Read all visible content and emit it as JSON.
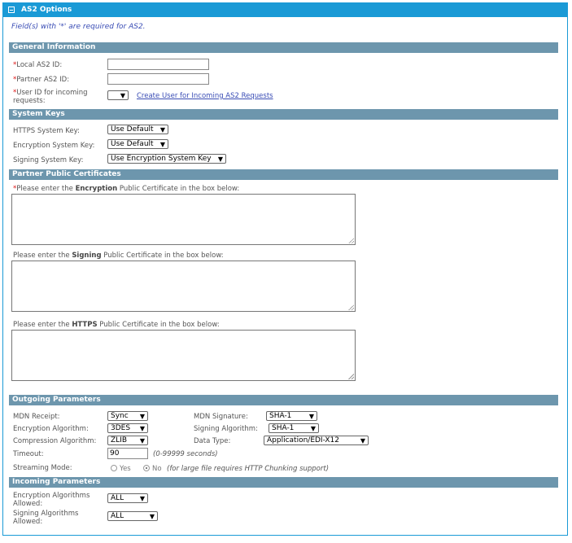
{
  "panel": {
    "title": "AS2 Options",
    "required_note": "Field(s) with '*' are required for AS2."
  },
  "general": {
    "header": "General Information",
    "local_id_label": "Local AS2 ID:",
    "partner_id_label": "Partner AS2 ID:",
    "user_id_label_1": "User ID for incoming",
    "user_id_label_2": "requests:",
    "create_user_link": "Create User for Incoming AS2 Requests"
  },
  "system_keys": {
    "header": "System Keys",
    "https_label": "HTTPS System Key:",
    "https_value": "Use Default",
    "encryption_label": "Encryption System Key:",
    "encryption_value": "Use Default",
    "signing_label": "Signing System Key:",
    "signing_value": "Use Encryption System Key"
  },
  "certs": {
    "header": "Partner Public Certificates",
    "enc_pre": "Please enter the ",
    "enc_bold": "Encryption",
    "enc_post": " Public Certificate in the box below:",
    "sign_pre": "Please enter the ",
    "sign_bold": "Signing",
    "sign_post": " Public Certificate in the box below:",
    "https_pre": "Please enter the ",
    "https_bold": "HTTPS",
    "https_post": " Public Certificate in the box below:"
  },
  "outgoing": {
    "header": "Outgoing Parameters",
    "mdn_receipt_label": "MDN Receipt:",
    "mdn_receipt_value": "Sync",
    "mdn_signature_label": "MDN Signature:",
    "mdn_signature_value": "SHA-1",
    "enc_alg_label": "Encryption Algorithm:",
    "enc_alg_value": "3DES",
    "sign_alg_label": "Signing Algorithm:",
    "sign_alg_value": "SHA-1",
    "comp_alg_label": "Compression Algorithm:",
    "comp_alg_value": "ZLIB",
    "data_type_label": "Data Type:",
    "data_type_value": "Application/EDI-X12",
    "timeout_label": "Timeout:",
    "timeout_value": "90",
    "timeout_hint": "(0-99999 seconds)",
    "streaming_label": "Streaming Mode:",
    "yes_label": "Yes",
    "no_label": "No",
    "streaming_hint": "(for large file requires HTTP Chunking support)"
  },
  "incoming": {
    "header": "Incoming Parameters",
    "enc_allowed_1": "Encryption Algorithms",
    "enc_allowed_2": "Allowed:",
    "enc_allowed_value": "ALL",
    "sign_allowed_1": "Signing Algorithms",
    "sign_allowed_2": "Allowed:",
    "sign_allowed_value": "ALL"
  },
  "icons": {
    "collapse": "minus-box-icon",
    "dropdown": "triangle-down-icon"
  },
  "colors": {
    "title_bar": "#1a9ad6",
    "section_header": "#6d96ad",
    "required": "#dd1111",
    "link": "#3a4db5"
  }
}
